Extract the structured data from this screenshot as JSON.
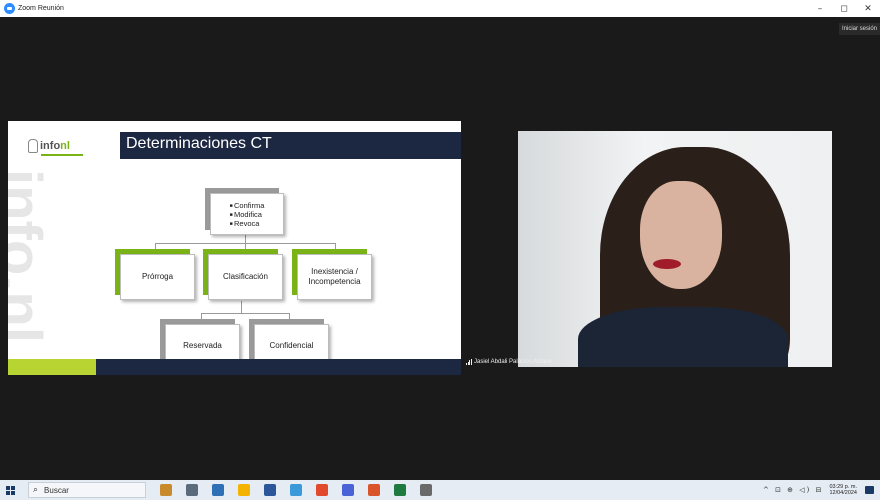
{
  "window": {
    "title": "Zoom Reunión",
    "signin_label": "Iniciar sesión"
  },
  "window_controls": {
    "minimize": "–",
    "maximize": "◻",
    "close": "✕"
  },
  "slide": {
    "title": "Determinaciones CT",
    "logo_prefix": "info",
    "logo_suffix": "nl",
    "watermark": "info.nl",
    "top_box_items": [
      "Confirma",
      "Modifica",
      "Revoca"
    ],
    "middle_boxes": [
      "Prórroga",
      "Clasificación",
      "Inexistencia / Incompetencia"
    ],
    "bottom_boxes": [
      "Reservada",
      "Confidencial"
    ]
  },
  "participant": {
    "name": "Jasiel Abdali Palacios Aldape"
  },
  "taskbar": {
    "search_placeholder": "Buscar",
    "tray_icons": "^ ⊡ ⊕ ◁) ⊟",
    "time": "03:29 p. m.",
    "date": "12/04/2024",
    "app_colors": [
      "#c88a2a",
      "#5a6b7c",
      "#2f6fb5",
      "#f2b400",
      "#2b579a",
      "#3a9ad9",
      "#e24a2e",
      "#4a64d8",
      "#d9532b",
      "#1f7a3f",
      "#6a6a6a"
    ]
  },
  "colors": {
    "navy": "#1c2841",
    "green": "#7ab317",
    "lime": "#b7d433"
  }
}
